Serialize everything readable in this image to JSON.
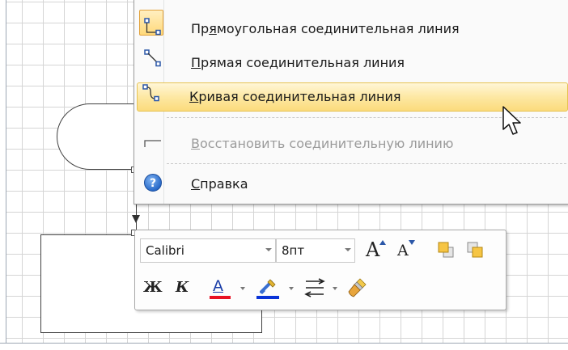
{
  "context_menu": {
    "items": [
      {
        "label_u": "Пр",
        "label_rest_before": "",
        "underline": "я",
        "label_after": "моугольная соединительная линия",
        "icon": "right-angle-connector-icon"
      },
      {
        "label_before": "",
        "underline": "П",
        "label_after": "рямая соединительная линия",
        "icon": "straight-connector-icon"
      },
      {
        "label_before": "",
        "underline": "К",
        "label_after": "ривая соединительная линия",
        "icon": "curved-connector-icon"
      },
      {
        "label_before": "",
        "underline": "В",
        "label_after": "осстановить соединительную линию",
        "icon": "reset-connector-icon"
      },
      {
        "label_before": "",
        "underline": "С",
        "label_after": "правка",
        "icon": "help-icon"
      }
    ]
  },
  "mini_toolbar": {
    "font_name": "Calibri",
    "font_size": "8пт",
    "bold_label": "Ж",
    "italic_label": "К",
    "font_color_letter": "A",
    "grow_letter": "A",
    "shrink_letter": "A",
    "font_color": "#e81123",
    "line_color": "#0a34d8"
  }
}
